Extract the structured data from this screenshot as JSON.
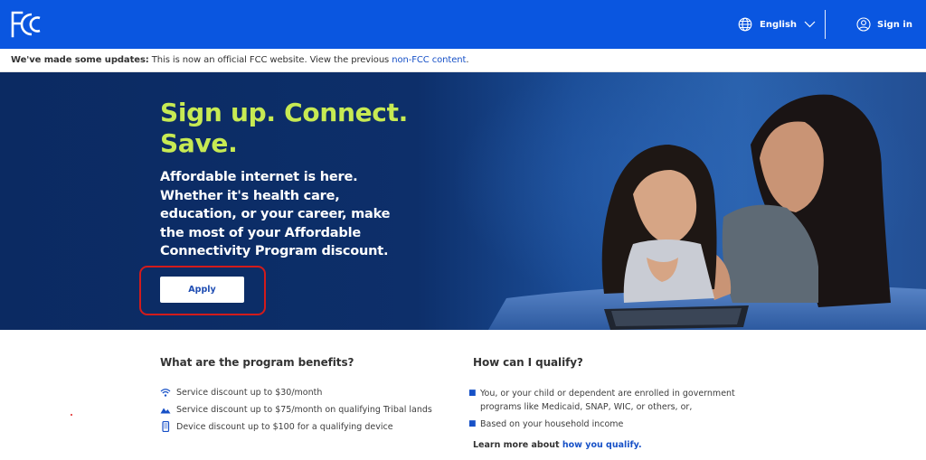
{
  "header": {
    "logo_text": "FCC",
    "language": "English",
    "signin_label": "Sign in"
  },
  "banner": {
    "bold": "We've made some updates:",
    "text": " This is now an official FCC website. View the previous ",
    "link": "non-FCC content",
    "end": "."
  },
  "hero": {
    "title": "Sign up. Connect. Save.",
    "body": "Affordable internet is here. Whether it's health care, education, or your career, make the most of your Affordable Connectivity Program discount.",
    "apply_label": "Apply"
  },
  "benefits": {
    "title": "What are the program benefits?",
    "items": [
      {
        "icon": "wifi-icon",
        "text": "Service discount up to $30/month"
      },
      {
        "icon": "mountain-icon",
        "text": "Service discount up to $75/month on qualifying Tribal lands"
      },
      {
        "icon": "phone-icon",
        "text": "Device discount up to $100 for a qualifying device"
      }
    ]
  },
  "qualify": {
    "title": "How can I qualify?",
    "items": [
      "You, or your child or dependent are enrolled in government programs like Medicaid, SNAP, WIC, or others, or,",
      "Based on your household income"
    ],
    "learn_text": "Learn more about ",
    "learn_link": "how you qualify."
  },
  "colors": {
    "nav_blue": "#0a56e0",
    "hero_navy": "#0c2d66",
    "accent_green": "#c7ea53",
    "link_blue": "#1751c7",
    "highlight_red": "#d21b1b"
  }
}
